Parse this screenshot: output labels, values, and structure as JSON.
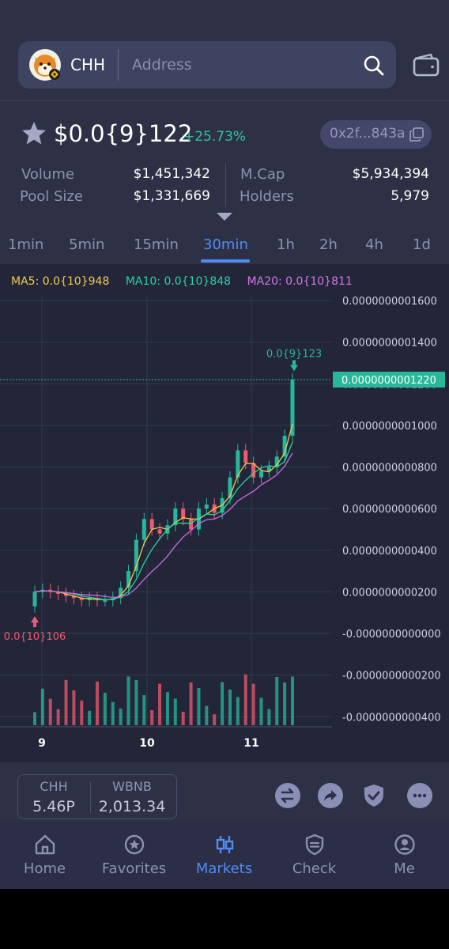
{
  "search": {
    "token_symbol": "CHH",
    "placeholder": "Address"
  },
  "icons": {
    "logo": "token-logo-shiba",
    "search": "search-icon",
    "wallet": "wallet-icon",
    "favorite": "star-icon",
    "copy": "copy-icon",
    "expand": "caret-down-icon"
  },
  "price_header": {
    "price": "$0.0{9}122",
    "change": "+25.73%",
    "contract": "0x2f...843a"
  },
  "stats": {
    "volume_label": "Volume",
    "volume_value": "$1,451,342",
    "pool_label": "Pool Size",
    "pool_value": "$1,331,669",
    "mcap_label": "M.Cap",
    "mcap_value": "$5,934,394",
    "holders_label": "Holders",
    "holders_value": "5,979"
  },
  "timeframes": [
    "1min",
    "5min",
    "15min",
    "30min",
    "1h",
    "2h",
    "4h",
    "1d"
  ],
  "active_timeframe": "30min",
  "ma_legend": {
    "ma5": "MA5: 0.0{10}948",
    "ma10": "MA10: 0.0{10}848",
    "ma20": "MA20: 0.0{10}811"
  },
  "chart_data": {
    "type": "candlestick",
    "y_axis_labels": [
      "0.0000000001600",
      "0.0000000001400",
      "0.0000000001200",
      "0.0000000001000",
      "0.0000000000800",
      "0.0000000000600",
      "0.0000000000400",
      "0.0000000000200",
      "-0.0000000000000",
      "-0.0000000000200",
      "-0.0000000000400"
    ],
    "y_axis_values": [
      1.6e-10,
      1.4e-10,
      1.2e-10,
      1e-10,
      8e-11,
      6e-11,
      4e-11,
      2e-11,
      0,
      -2e-11,
      -4e-11
    ],
    "x_axis_labels": [
      "9",
      "10",
      "11"
    ],
    "current_price_label": "0.0000000001220",
    "current_price": 1.22e-10,
    "high_annotation": "0.0{9}123",
    "high_value": 1.23e-10,
    "low_annotation": "0.0{10}106",
    "low_value": 1.06e-11,
    "close_series_approx": [
      0.2,
      0.21,
      0.2,
      0.19,
      0.18,
      0.17,
      0.16,
      0.17,
      0.16,
      0.16,
      0.17,
      0.22,
      0.3,
      0.45,
      0.55,
      0.5,
      0.48,
      0.52,
      0.6,
      0.55,
      0.5,
      0.6,
      0.62,
      0.58,
      0.65,
      0.75,
      0.88,
      0.82,
      0.75,
      0.78,
      0.8,
      0.85,
      0.95,
      1.22
    ],
    "ma_colors": {
      "ma5": "#f2c94c",
      "ma10": "#27d3a3",
      "ma20": "#c86ce0"
    },
    "up_color": "#27b89a",
    "down_color": "#f05a6e"
  },
  "pair": {
    "base_symbol": "CHH",
    "base_amount": "5.46P",
    "quote_symbol": "WBNB",
    "quote_amount": "2,013.34"
  },
  "actions": [
    "swap-icon",
    "share-icon",
    "shield-check-icon",
    "chat-icon"
  ],
  "nav": {
    "items": [
      {
        "label": "Home",
        "icon": "home-icon"
      },
      {
        "label": "Favorites",
        "icon": "favorites-icon"
      },
      {
        "label": "Markets",
        "icon": "candlestick-icon"
      },
      {
        "label": "Check",
        "icon": "shield-check-icon"
      },
      {
        "label": "Me",
        "icon": "user-icon"
      }
    ],
    "active": "Markets"
  }
}
